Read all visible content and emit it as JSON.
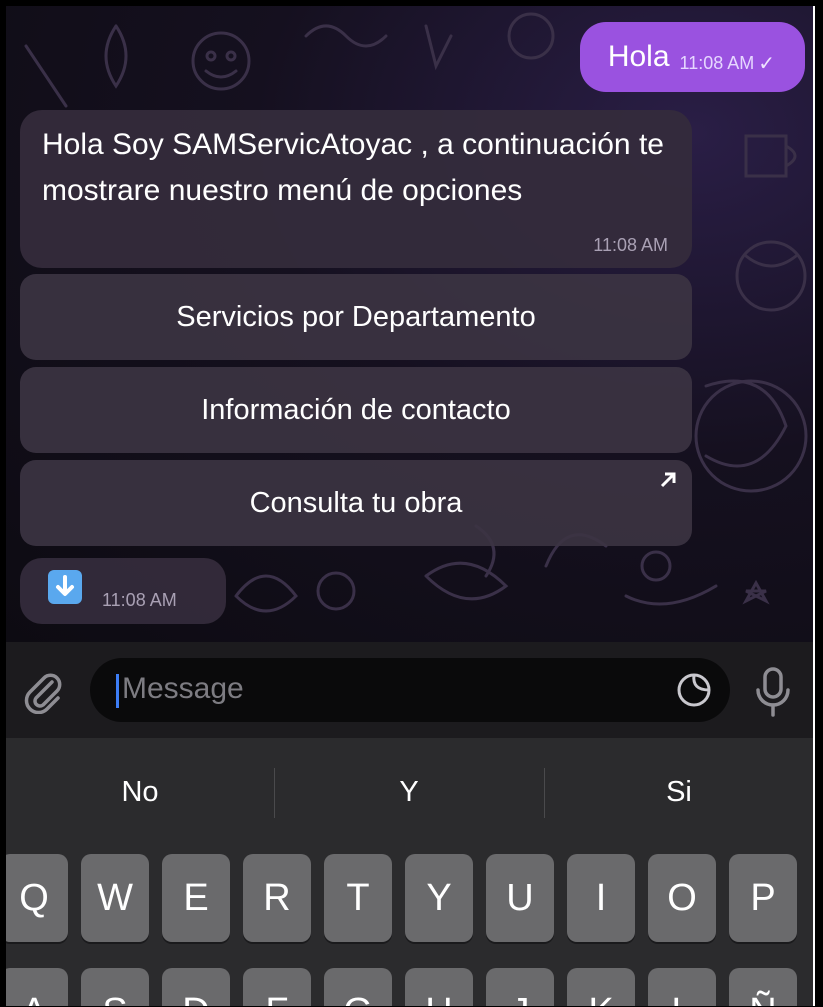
{
  "chat": {
    "outgoing": {
      "text": "Hola",
      "time": "11:08 AM",
      "status": "✓"
    },
    "incoming": {
      "text": "Hola Soy SAMServicAtoyac  , a continuación te mostrare nuestro menú de opciones",
      "time": "11:08 AM"
    },
    "inline_buttons": [
      {
        "label": "Servicios por Departamento"
      },
      {
        "label": "Información de contacto"
      },
      {
        "label": "Consulta tu obra",
        "icon": "external-link-arrow-icon"
      }
    ],
    "file_message": {
      "icon": "download-arrow-icon",
      "time": "11:08 AM"
    }
  },
  "input": {
    "placeholder": "Message"
  },
  "keyboard": {
    "suggestions": [
      "No",
      "Y",
      "Si"
    ],
    "row1": [
      "Q",
      "W",
      "E",
      "R",
      "T",
      "Y",
      "U",
      "I",
      "O",
      "P"
    ],
    "row2": [
      "A",
      "S",
      "D",
      "F",
      "G",
      "H",
      "J",
      "K",
      "L",
      "Ñ"
    ]
  },
  "colors": {
    "outgoing_bubble": "#9a52e0",
    "incoming_bubble": "#342c3c",
    "accent_caret": "#3d7ef6",
    "download_icon": "#5aa8ee"
  }
}
